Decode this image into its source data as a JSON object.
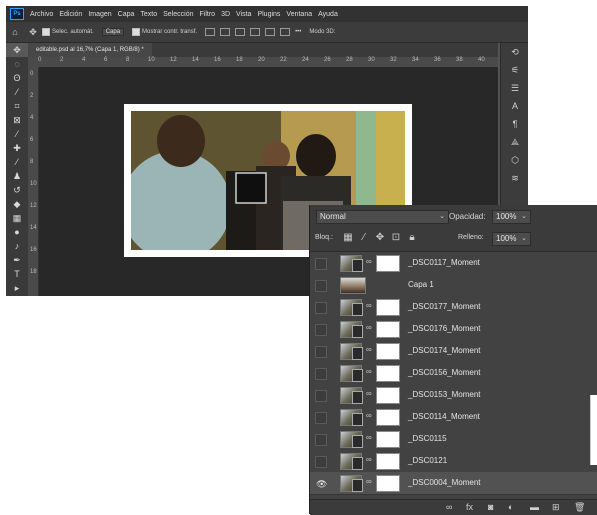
{
  "app": {
    "logo": "Ps"
  },
  "menu": [
    "Archivo",
    "Edición",
    "Imagen",
    "Capa",
    "Texto",
    "Selección",
    "Filtro",
    "3D",
    "Vista",
    "Plugins",
    "Ventana",
    "Ayuda"
  ],
  "options_bar": {
    "auto_select_label": "Selec. automát.",
    "auto_select_value": "Capa",
    "transform_controls_label": "Mostrar contr. transf.",
    "mode_3d_label": "Modo 3D:"
  },
  "document_tab": {
    "title": "editable.psd al 16,7% (Capa 1, RGB/8) *"
  },
  "ruler": {
    "horizontal": [
      "0",
      "2",
      "4",
      "6",
      "8",
      "10",
      "12",
      "14",
      "16",
      "18",
      "20",
      "22",
      "24",
      "26",
      "28",
      "30",
      "32",
      "34",
      "36",
      "38",
      "40"
    ],
    "vertical": [
      "0",
      "2",
      "4",
      "6",
      "8",
      "10",
      "12",
      "14",
      "16",
      "18"
    ]
  },
  "layers_panel": {
    "blend_mode": "Normal",
    "opacity_label": "Opacidad:",
    "opacity_value": "100%",
    "lock_label": "Bloq.:",
    "fill_label": "Relleno:",
    "fill_value": "100%",
    "layers": [
      {
        "name": "_DSC0117_Moment",
        "visible": false,
        "type": "smart",
        "selected": false
      },
      {
        "name": "Capa 1",
        "visible": false,
        "type": "plain",
        "selected": false
      },
      {
        "name": "_DSC0177_Moment",
        "visible": false,
        "type": "smart",
        "selected": false
      },
      {
        "name": "_DSC0176_Moment",
        "visible": false,
        "type": "smart",
        "selected": false
      },
      {
        "name": "_DSC0174_Moment",
        "visible": false,
        "type": "smart",
        "selected": false
      },
      {
        "name": "_DSC0156_Moment",
        "visible": false,
        "type": "smart",
        "selected": false
      },
      {
        "name": "_DSC0153_Moment",
        "visible": false,
        "type": "smart",
        "selected": false
      },
      {
        "name": "_DSC0114_Moment",
        "visible": false,
        "type": "smart",
        "selected": false
      },
      {
        "name": "_DSC0115",
        "visible": false,
        "type": "smart",
        "selected": false
      },
      {
        "name": "_DSC0121",
        "visible": false,
        "type": "smart",
        "selected": false
      },
      {
        "name": "_DSC0004_Moment",
        "visible": true,
        "type": "smart",
        "selected": true
      }
    ],
    "bottom_icons": [
      "link-icon",
      "fx-icon",
      "mask-icon",
      "adjustment-icon",
      "group-icon",
      "new-layer-icon",
      "trash-icon"
    ]
  }
}
